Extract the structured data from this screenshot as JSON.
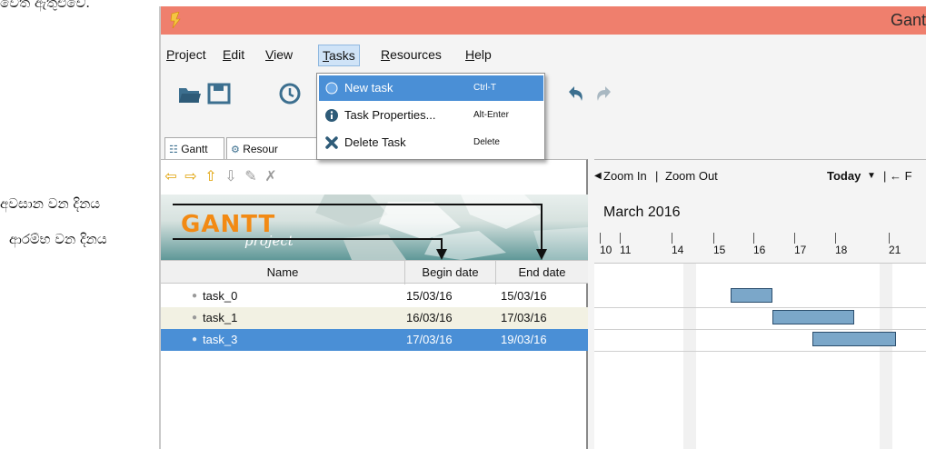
{
  "top_text": "වෙත ඇතුළුවේ.",
  "window": {
    "title": "Gant"
  },
  "menu": {
    "items": [
      "Project",
      "Edit",
      "View",
      "Tasks",
      "Resources",
      "Help"
    ],
    "active": "Tasks"
  },
  "dropdown": {
    "items": [
      {
        "label": "New task",
        "shortcut": "Ctrl-T",
        "icon": "new-task-icon"
      },
      {
        "label": "Task Properties...",
        "shortcut": "Alt-Enter",
        "icon": "info-icon"
      },
      {
        "label": "Delete Task",
        "shortcut": "Delete",
        "icon": "delete-x-icon"
      }
    ]
  },
  "tabs": [
    {
      "label": "Gantt"
    },
    {
      "label": "Resour"
    }
  ],
  "banner": {
    "logo": "GANTT",
    "sub": "project"
  },
  "grid": {
    "headers": {
      "name": "Name",
      "begin": "Begin date",
      "end": "End date"
    },
    "rows": [
      {
        "name": "task_0",
        "begin": "15/03/16",
        "end": "15/03/16",
        "selected": false
      },
      {
        "name": "task_1",
        "begin": "16/03/16",
        "end": "17/03/16",
        "selected": false
      },
      {
        "name": "task_3",
        "begin": "17/03/16",
        "end": "19/03/16",
        "selected": true
      }
    ]
  },
  "chart": {
    "zoom_in": "Zoom In",
    "separator": "|",
    "zoom_out": "Zoom Out",
    "today": "Today",
    "month": "March 2016",
    "days": [
      "10",
      "11",
      "14",
      "15",
      "16",
      "17",
      "18",
      "21"
    ],
    "truncated": "| ← F"
  },
  "annotations": {
    "end_date": "අවසාන වන දිනය",
    "begin_date": "ආරම්භ වන දිනය"
  },
  "colors": {
    "titlebar": "#ef7f6d",
    "selection": "#4a8fd6",
    "bar_fill": "#7ba7c9",
    "logo": "#f28a14"
  }
}
